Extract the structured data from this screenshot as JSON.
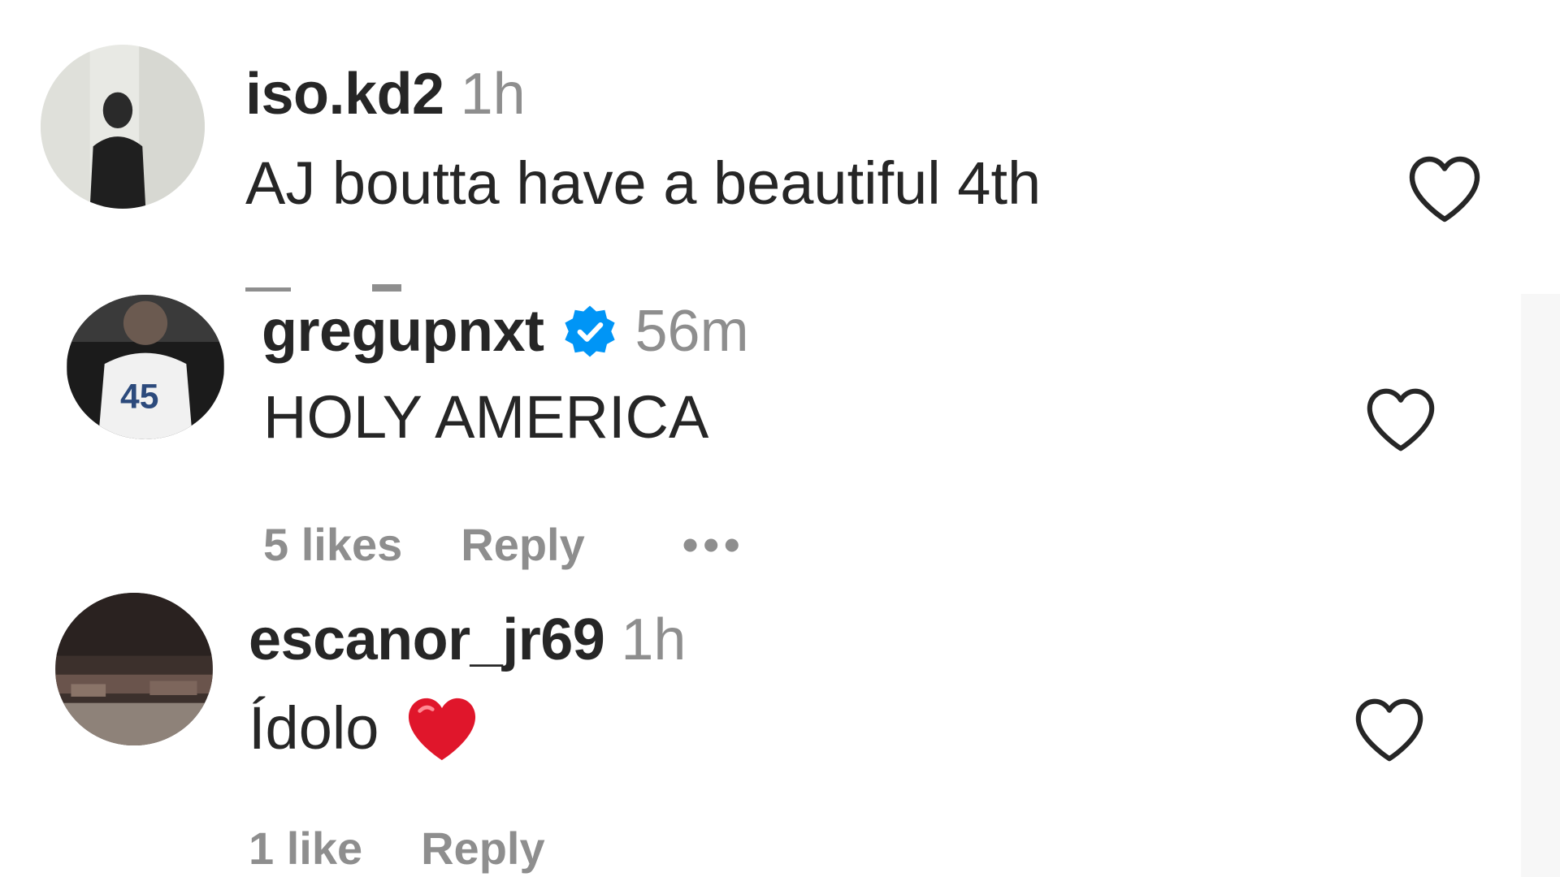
{
  "comments": [
    {
      "username": "iso.kd2",
      "time": "1h",
      "text": "AJ boutta have a beautiful 4th",
      "verified": false,
      "likes": "",
      "reply_label": ""
    },
    {
      "username": "gregupnxt",
      "time": "56m",
      "text": "HOLY AMERICA",
      "verified": true,
      "likes": "5 likes",
      "reply_label": "Reply",
      "more": "•••"
    },
    {
      "username": "escanor_jr69",
      "time": "1h",
      "text": "Ídolo",
      "emoji": "red-heart-emoji",
      "verified": false,
      "likes": "1 like",
      "reply_label": "Reply"
    }
  ],
  "icons": {
    "like": "heart-outline-icon",
    "verified": "verified-badge-icon",
    "more": "more-options-icon"
  },
  "colors": {
    "text": "#262626",
    "muted": "#8e8e8e",
    "verified_blue": "#0095f6",
    "emoji_red": "#e0162b"
  }
}
